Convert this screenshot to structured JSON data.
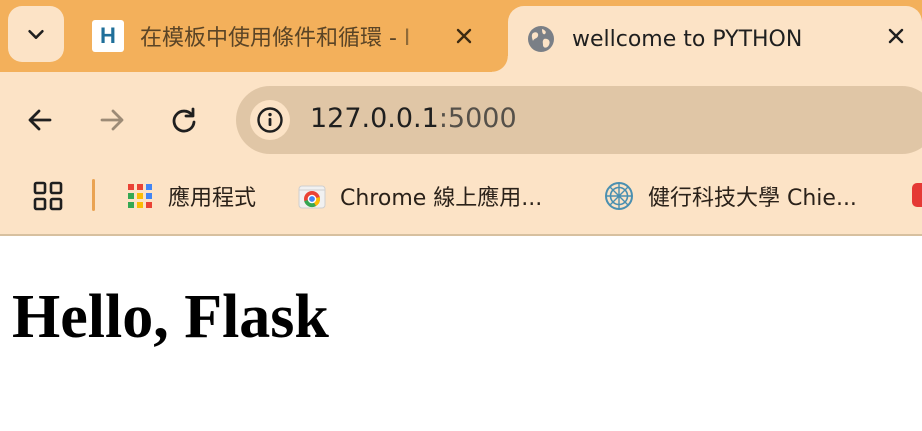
{
  "tabs": [
    {
      "title": "在模板中使用條件和循環 - I",
      "favicon": "h-icon",
      "active": false
    },
    {
      "title": "wellcome to PYTHON",
      "favicon": "globe-icon",
      "active": true
    }
  ],
  "address_bar": {
    "host": "127.0.0.1",
    "port": ":5000"
  },
  "bookmarks": [
    {
      "label": "應用程式",
      "icon": "apps-grid-icon"
    },
    {
      "label": "Chrome 線上應用...",
      "icon": "chrome-icon"
    },
    {
      "label": "健行科技大學 Chie...",
      "icon": "university-logo-icon"
    }
  ],
  "page": {
    "heading": "Hello, Flask"
  },
  "colors": {
    "tab_strip": "#f3b05b",
    "toolbar": "#fce3c6",
    "omnibox": "#e0c6a6",
    "page_background": "#ffffff"
  }
}
